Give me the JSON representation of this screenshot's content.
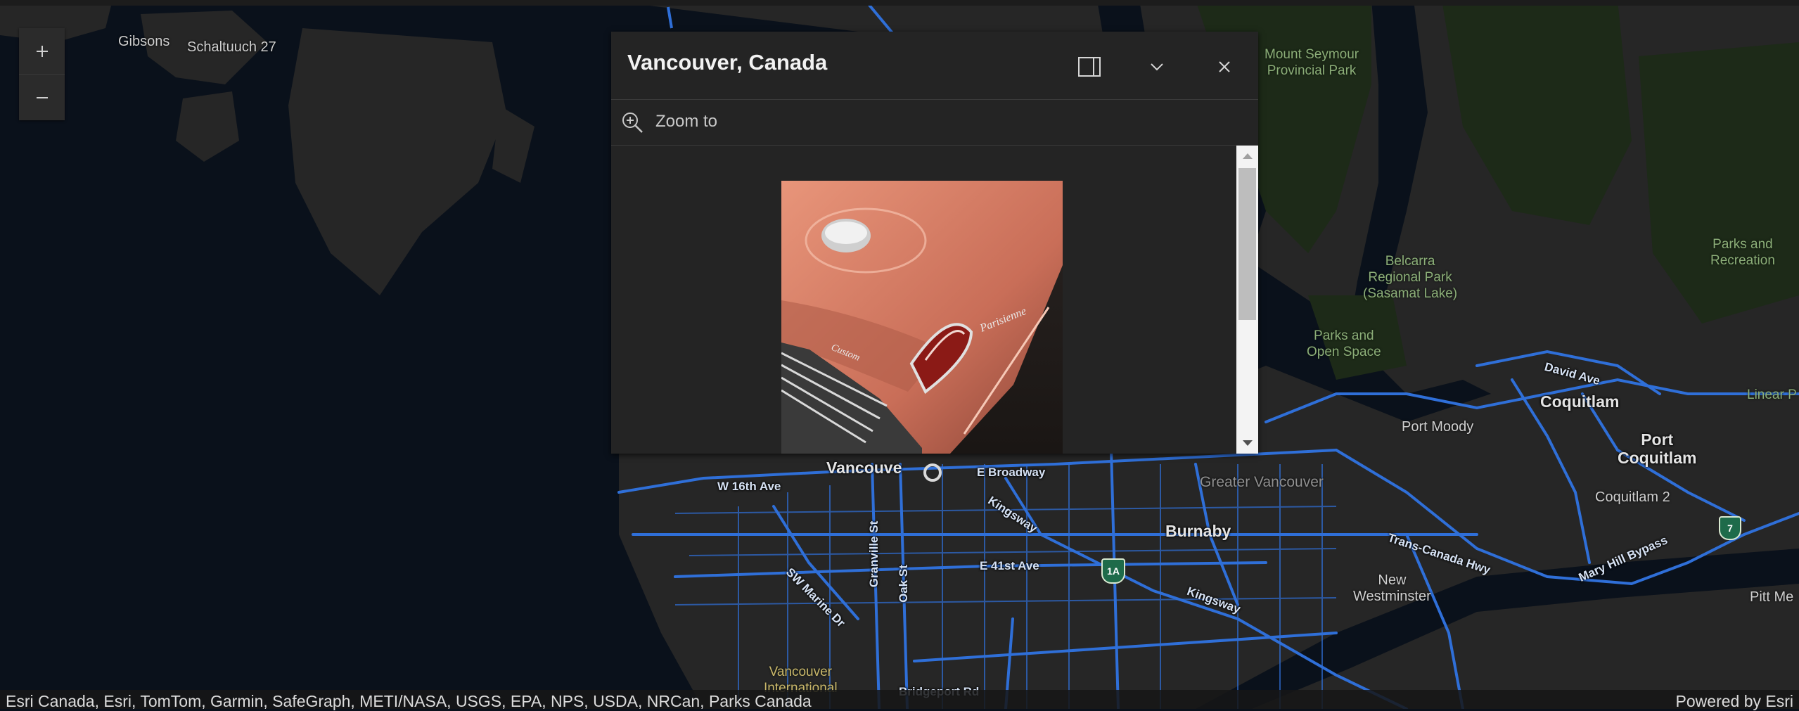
{
  "map": {
    "zoom_in_label": "+",
    "zoom_out_label": "–",
    "labels": {
      "gibsons": "Gibsons",
      "schaltuuch": "Schaltuuch 27",
      "mount_seymour": "Mount Seymour\nProvincial Park",
      "belcarra": "Belcarra\nRegional Park\n(Sasamat Lake)",
      "parks_rec": "Parks and\nRecreation",
      "parks_open": "Parks and\nOpen Space",
      "david_ave": "David Ave",
      "linear_park": "Linear P",
      "coquitlam": "Coquitlam",
      "port_moody": "Port Moody",
      "port_coquitlam": "Port\nCoquitlam",
      "coquitlam2": "Coquitlam 2",
      "greater_vancouver": "Greater Vancouver",
      "burnaby": "Burnaby",
      "vancouver": "Vancouve",
      "e_broadway": "E Broadway",
      "w16": "W 16th Ave",
      "kingsway1": "Kingsway",
      "kingsway2": "Kingsway",
      "granville": "Granville St",
      "oak": "Oak St",
      "sw_marine": "SW Marine Dr",
      "e41": "E 41st Ave",
      "trans_canada": "Trans-Canada Hwy",
      "mary_hill": "Mary Hill Bypass",
      "new_westminster": "New\nWestminster",
      "pitt": "Pitt Me",
      "yvr": "Vancouver\nInternational",
      "bridgeport": "Bridgeport Rd",
      "shield_1a": "1A",
      "shield_7": "7"
    }
  },
  "popup": {
    "title": "Vancouver, Canada",
    "zoom_to_label": "Zoom to",
    "dock_icon": "dock-icon",
    "collapse_icon": "chevron-down-icon",
    "close_icon": "close-icon"
  },
  "attribution": {
    "text": "Esri Canada, Esri, TomTom, Garmin, SafeGraph, METI/NASA, USGS, EPA, NPS, USDA, NRCan, Parks Canada",
    "powered_by": "Powered by Esri"
  },
  "colors": {
    "water": "#0a111b",
    "land": "#262626",
    "park": "#1d2a18",
    "road": "#2f6fd8"
  }
}
